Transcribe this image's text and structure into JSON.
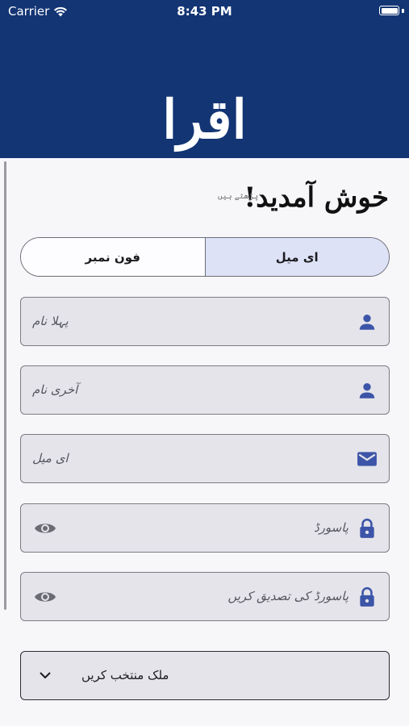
{
  "status_bar": {
    "carrier": "Carrier",
    "time": "8:43 PM"
  },
  "header": {
    "logo": "اقرا"
  },
  "welcome": {
    "title": "خوش آمدید!",
    "tagline": "پڑھتے ہیں"
  },
  "tabs": {
    "phone": "فون نمبر",
    "email": "ای میل",
    "selected": "ای میل"
  },
  "form": {
    "first_name_placeholder": "پہلا نام",
    "last_name_placeholder": "آخری نام",
    "email_placeholder": "ای میل",
    "password_placeholder": "پاسورڈ",
    "confirm_password_placeholder": "پاسورڈ کی تصدیق کریں",
    "country_select_label": "ملک منتخب کریں"
  },
  "icons": {
    "first_name": "person-icon",
    "last_name": "person-icon",
    "email": "envelope-icon",
    "password": "lock-icon",
    "password_toggle": "eye-icon",
    "country": "chevron-down-icon"
  },
  "colors": {
    "header_bg": "#133574",
    "accent_icon": "#3c55a8",
    "selected_tab_bg": "#dde2f6",
    "field_bg": "#e4e4ea"
  }
}
